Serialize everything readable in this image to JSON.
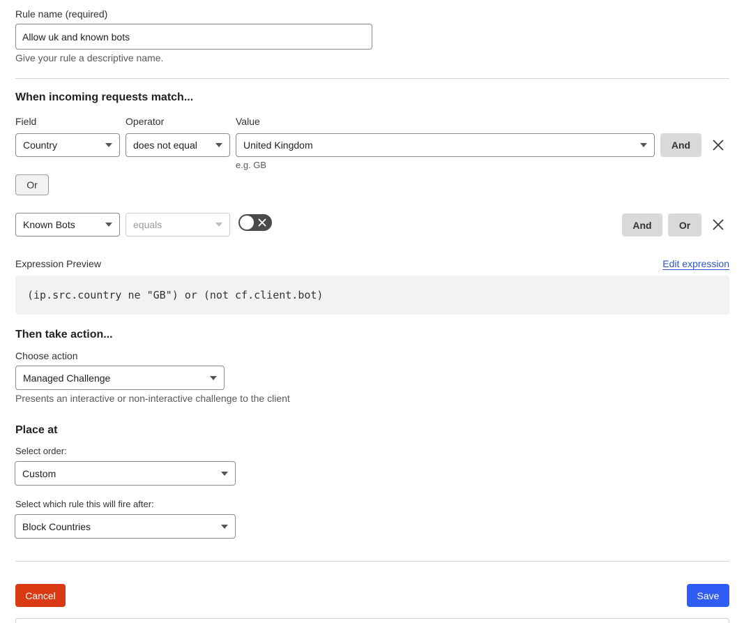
{
  "rule_name": {
    "label": "Rule name (required)",
    "value": "Allow uk and known bots",
    "hint": "Give your rule a descriptive name."
  },
  "match": {
    "heading": "When incoming requests match...",
    "field_label": "Field",
    "operator_label": "Operator",
    "value_label": "Value",
    "row1": {
      "field": "Country",
      "operator": "does not equal",
      "value": "United Kingdom",
      "value_hint": "e.g. GB",
      "and_label": "And"
    },
    "or_label": "Or",
    "row2": {
      "field": "Known Bots",
      "operator": "equals",
      "toggle_on": false,
      "and_label": "And",
      "or_label": "Or"
    }
  },
  "expression": {
    "label": "Expression Preview",
    "edit_link": "Edit expression",
    "code": "(ip.src.country ne \"GB\") or (not cf.client.bot)"
  },
  "action": {
    "heading": "Then take action...",
    "choose_label": "Choose action",
    "selected": "Managed Challenge",
    "hint": "Presents an interactive or non-interactive challenge to the client"
  },
  "place": {
    "heading": "Place at",
    "order_label": "Select order:",
    "order_value": "Custom",
    "after_label": "Select which rule this will fire after:",
    "after_value": "Block Countries"
  },
  "footer": {
    "cancel_label": "Cancel",
    "save_label": "Save"
  },
  "colors": {
    "cancel": "#d93a13",
    "save": "#2f5cf5",
    "link": "#2f54c9",
    "toggle_off": "#4a4a4a"
  }
}
